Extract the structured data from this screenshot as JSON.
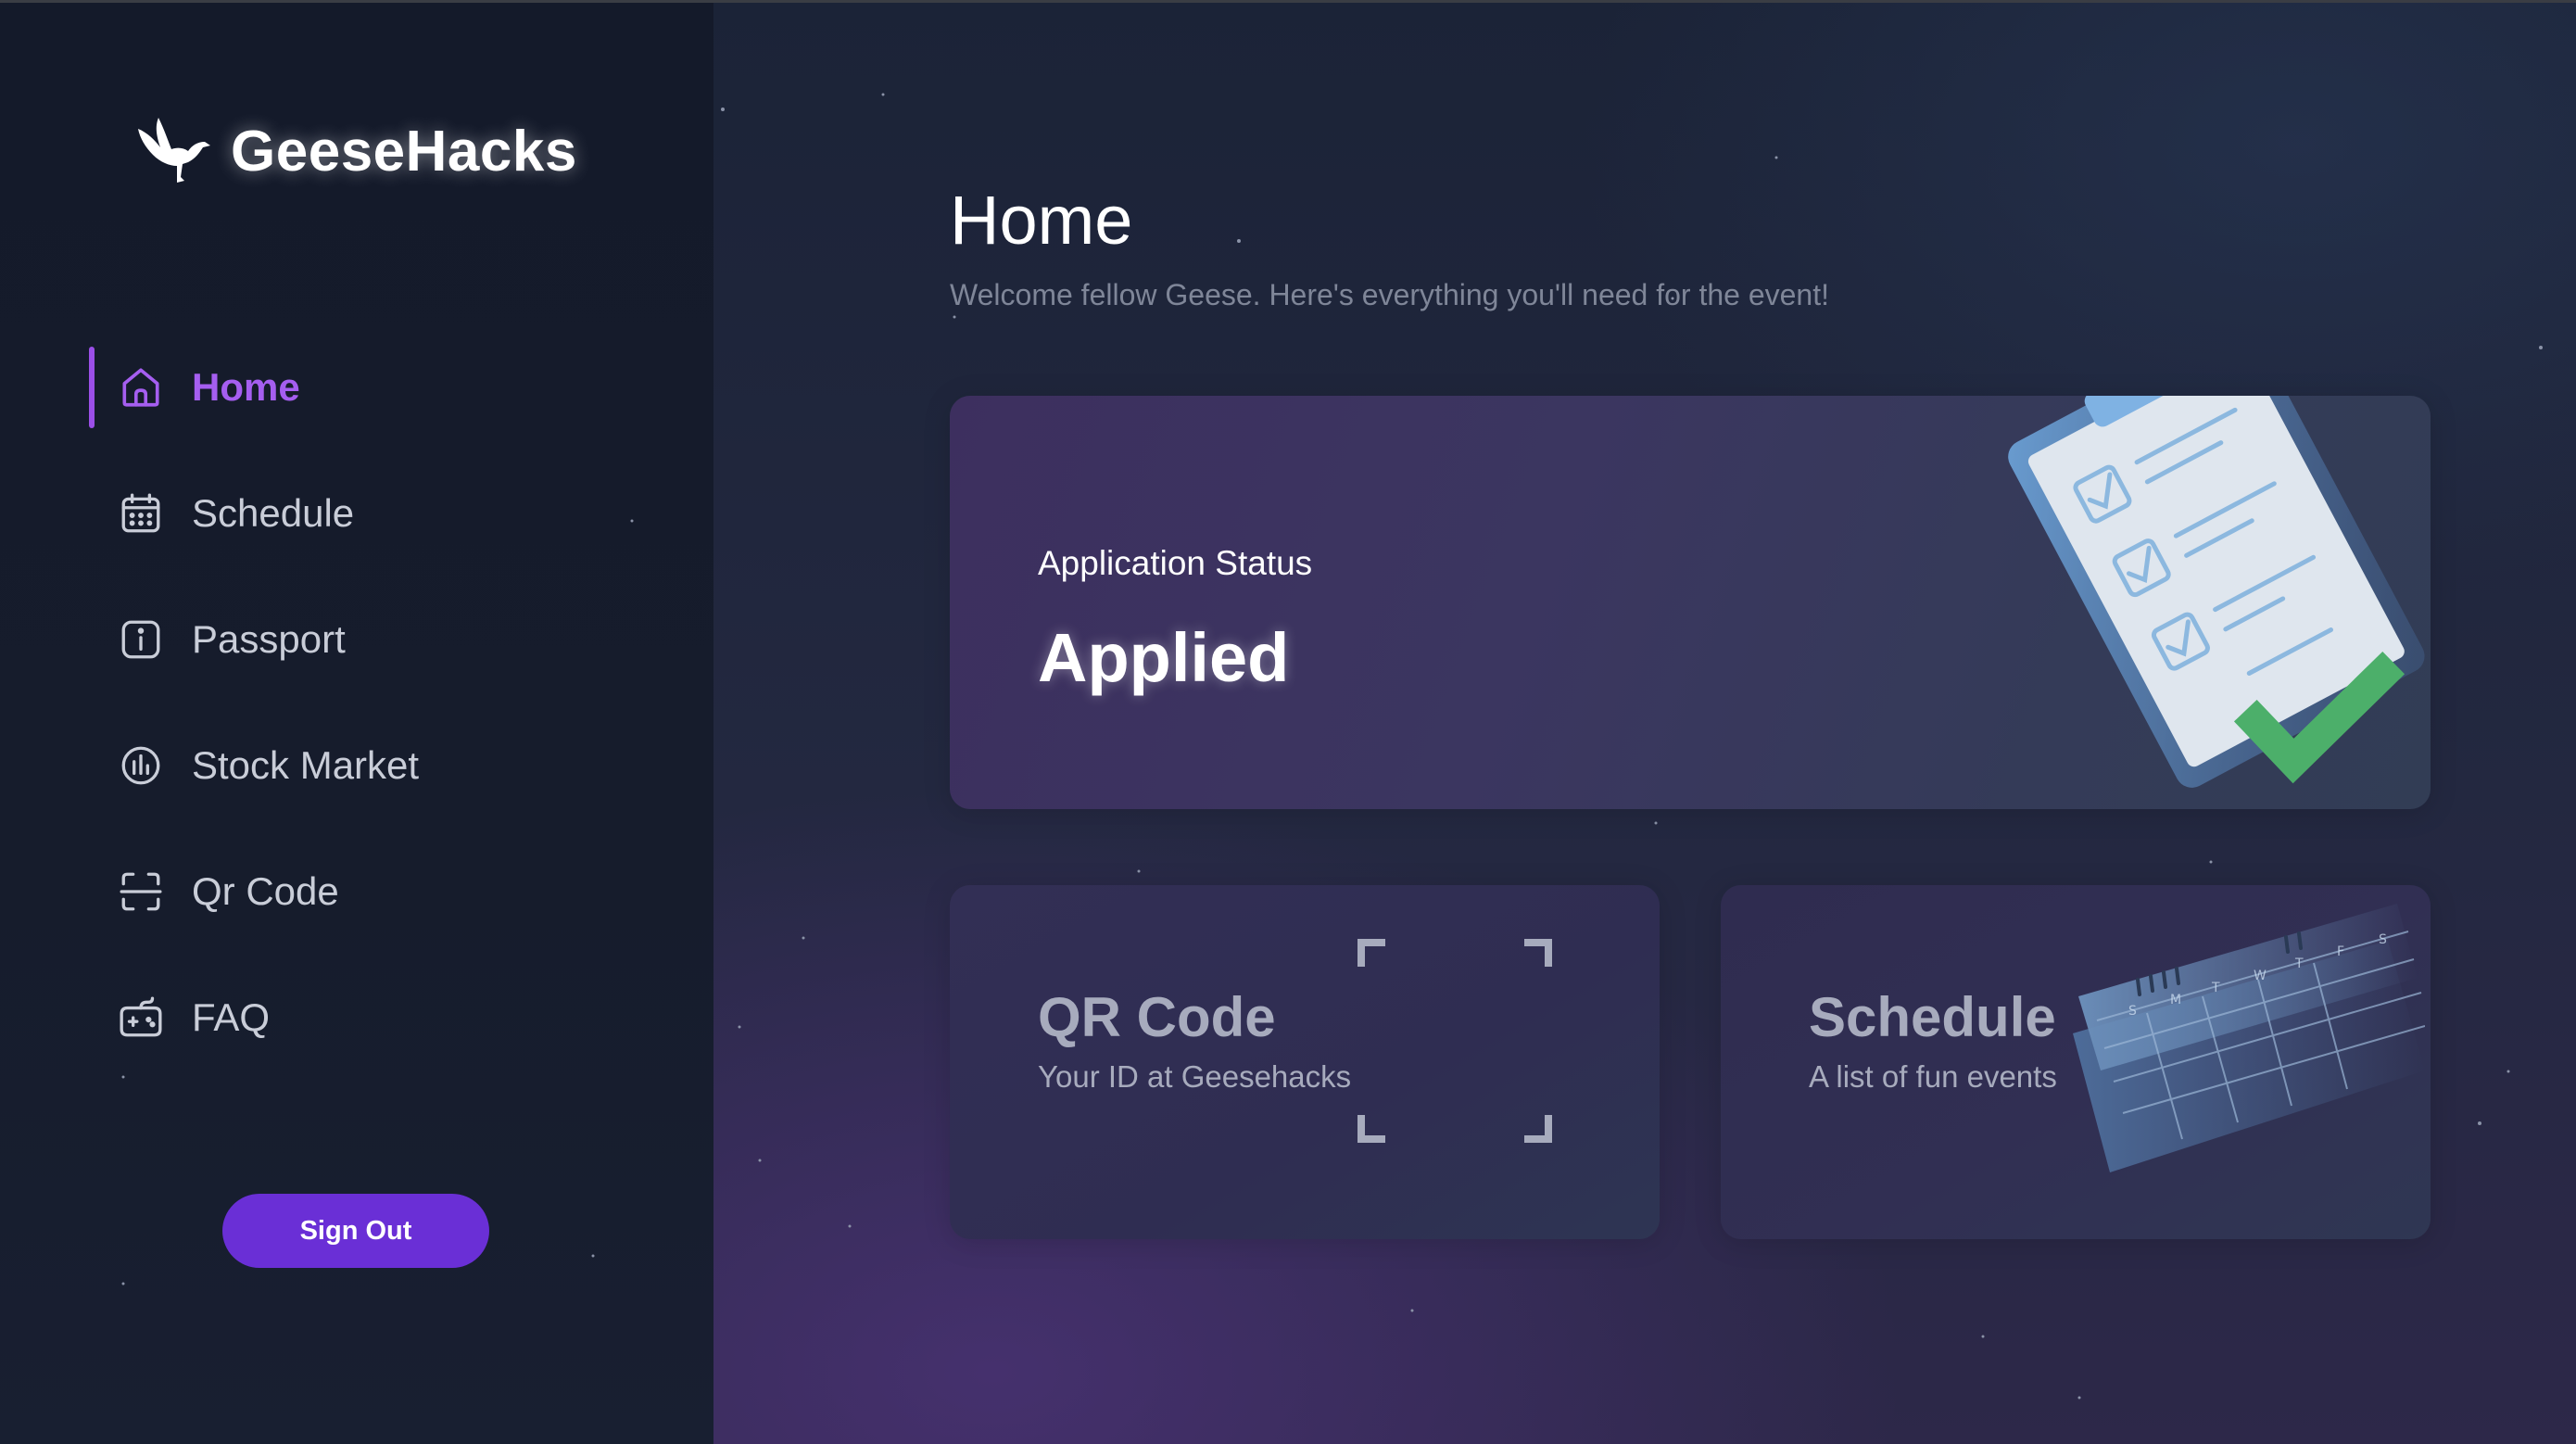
{
  "brand": {
    "name": "GeeseHacks",
    "logo_icon": "goose-icon"
  },
  "sidebar": {
    "items": [
      {
        "label": "Home",
        "icon": "home-icon",
        "active": true
      },
      {
        "label": "Schedule",
        "icon": "calendar-icon",
        "active": false
      },
      {
        "label": "Passport",
        "icon": "info-icon",
        "active": false
      },
      {
        "label": "Stock Market",
        "icon": "chart-icon",
        "active": false
      },
      {
        "label": "Qr Code",
        "icon": "scan-icon",
        "active": false
      },
      {
        "label": "FAQ",
        "icon": "gamepad-icon",
        "active": false
      }
    ],
    "sign_out": "Sign Out"
  },
  "main": {
    "title": "Home",
    "subtitle": "Welcome fellow Geese. Here's everything you'll need for the event!",
    "status_card": {
      "label": "Application Status",
      "value": "Applied"
    },
    "qr_card": {
      "title": "QR Code",
      "subtitle": "Your ID at Geesehacks"
    },
    "schedule_card": {
      "title": "Schedule",
      "subtitle": "A list of fun events",
      "calendar_letters": [
        "S",
        "M",
        "T",
        "W",
        "T",
        "F",
        "S"
      ]
    }
  },
  "colors": {
    "accent": "#9b4fe8",
    "button": "#6a2fd6",
    "sidebar_bg": "#151b2b",
    "main_bg": "#1f2539",
    "check_green": "#4caf6a"
  }
}
